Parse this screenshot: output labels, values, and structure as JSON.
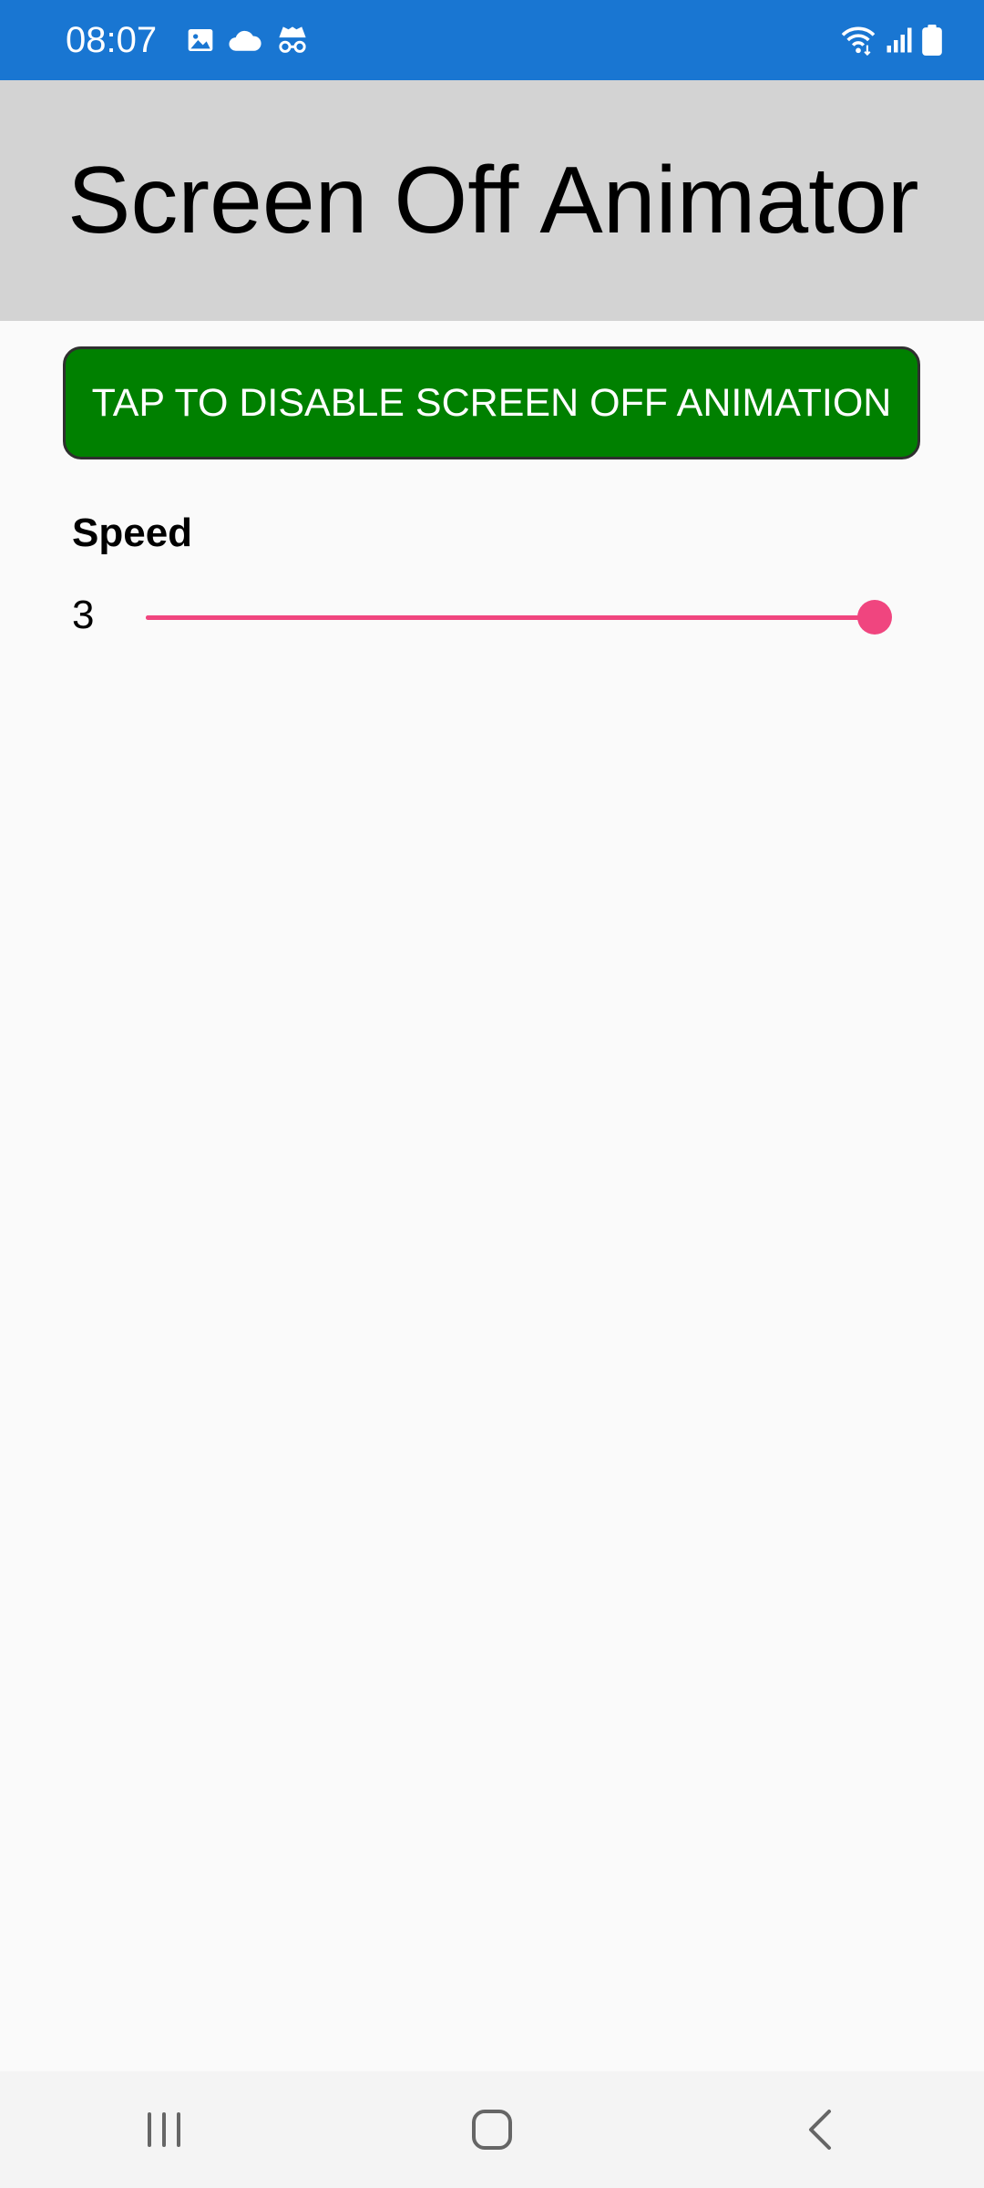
{
  "status_bar": {
    "time": "08:07",
    "left_icons": [
      "image-icon",
      "cloud-icon",
      "incognito-icon"
    ],
    "right_icons": [
      "wifi-icon",
      "signal-icon",
      "battery-icon"
    ],
    "background": "#1976d2"
  },
  "header": {
    "title": "Screen Off Animator",
    "background": "#d3d3d3"
  },
  "toggle": {
    "label": "TAP TO DISABLE SCREEN OFF ANIMATION",
    "color": "#008000"
  },
  "speed": {
    "label": "Speed",
    "value": "3",
    "slider_fraction": 1.0,
    "accent": "#f0457f"
  },
  "nav_bar": {
    "buttons": [
      "recent-apps-icon",
      "home-icon",
      "back-icon"
    ]
  }
}
